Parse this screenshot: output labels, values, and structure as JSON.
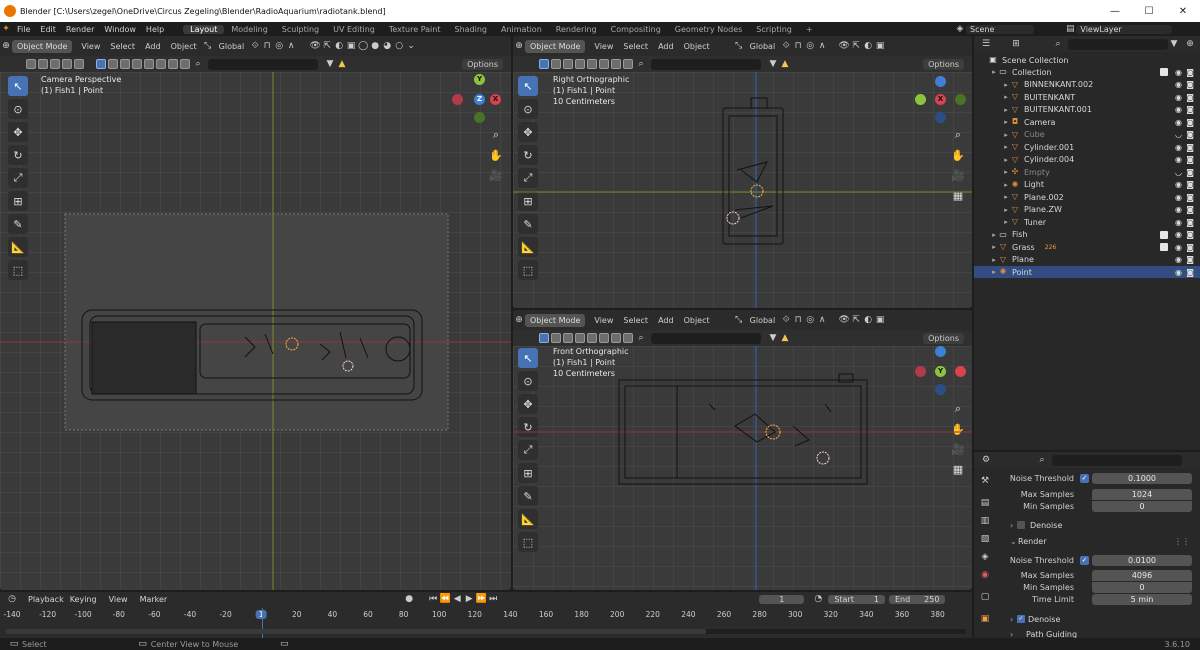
{
  "window": {
    "title": "Blender [C:\\Users\\zegel\\OneDrive\\Circus Zegeling\\Blender\\RadioAquarium\\radiotank.blend]",
    "minimize": "—",
    "maximize": "☐",
    "close": "✕"
  },
  "menus": [
    "File",
    "Edit",
    "Render",
    "Window",
    "Help"
  ],
  "workspaces": [
    "Layout",
    "Modeling",
    "Sculpting",
    "UV Editing",
    "Texture Paint",
    "Shading",
    "Animation",
    "Rendering",
    "Compositing",
    "Geometry Nodes",
    "Scripting"
  ],
  "active_workspace": "Layout",
  "add_workspace": "+",
  "scene": "Scene",
  "view_layer": "ViewLayer",
  "viewport_header": {
    "mode": "Object Mode",
    "view": "View",
    "select": "Select",
    "add": "Add",
    "object": "Object",
    "orientation": "Global",
    "options": "Options"
  },
  "viewports": {
    "camera": {
      "line1": "Camera Perspective",
      "line2": "(1) Fish1 | Point"
    },
    "right": {
      "line1": "Right Orthographic",
      "line2": "(1) Fish1 | Point",
      "line3": "10 Centimeters"
    },
    "front": {
      "line1": "Front Orthographic",
      "line2": "(1) Fish1 | Point",
      "line3": "10 Centimeters"
    }
  },
  "gizmo_labels": {
    "y": "Y",
    "x": "X",
    "z": "Z"
  },
  "outliner": {
    "root": "Scene Collection",
    "items": [
      {
        "label": "Collection",
        "icon": "collection-icon",
        "color": "#e6e6e6",
        "level": 1,
        "dim": false,
        "selected": false,
        "checked": true
      },
      {
        "label": "BINNENKANT.002",
        "icon": "mesh-icon",
        "color": "#e08a3c",
        "level": 2,
        "dim": false,
        "selected": false,
        "checked": false
      },
      {
        "label": "BUITENKANT",
        "icon": "mesh-icon",
        "color": "#e08a3c",
        "level": 2,
        "dim": false,
        "selected": false,
        "checked": false
      },
      {
        "label": "BUITENKANT.001",
        "icon": "mesh-icon",
        "color": "#e08a3c",
        "level": 2,
        "dim": false,
        "selected": false,
        "checked": false
      },
      {
        "label": "Camera",
        "icon": "camera-icon",
        "color": "#e08a3c",
        "level": 2,
        "dim": false,
        "selected": false,
        "checked": false
      },
      {
        "label": "Cube",
        "icon": "mesh-icon",
        "color": "#e08a3c",
        "level": 2,
        "dim": true,
        "selected": false,
        "checked": false
      },
      {
        "label": "Cylinder.001",
        "icon": "mesh-icon",
        "color": "#e08a3c",
        "level": 2,
        "dim": false,
        "selected": false,
        "checked": false
      },
      {
        "label": "Cylinder.004",
        "icon": "mesh-icon",
        "color": "#e08a3c",
        "level": 2,
        "dim": false,
        "selected": false,
        "checked": false
      },
      {
        "label": "Empty",
        "icon": "empty-icon",
        "color": "#e08a3c",
        "level": 2,
        "dim": true,
        "selected": false,
        "checked": false
      },
      {
        "label": "Light",
        "icon": "light-icon",
        "color": "#e08a3c",
        "level": 2,
        "dim": false,
        "selected": false,
        "checked": false
      },
      {
        "label": "Plane.002",
        "icon": "mesh-icon",
        "color": "#e08a3c",
        "level": 2,
        "dim": false,
        "selected": false,
        "checked": false
      },
      {
        "label": "Plane.ZW",
        "icon": "mesh-icon",
        "color": "#e08a3c",
        "level": 2,
        "dim": false,
        "selected": false,
        "checked": false
      },
      {
        "label": "Tuner",
        "icon": "mesh-icon",
        "color": "#e08a3c",
        "level": 2,
        "dim": false,
        "selected": false,
        "checked": false
      },
      {
        "label": "Fish",
        "icon": "collection-icon",
        "color": "#e6e6e6",
        "level": 1,
        "dim": false,
        "selected": false,
        "checked": true
      },
      {
        "label": "Grass",
        "icon": "mesh-icon",
        "color": "#e08a3c",
        "level": 1,
        "dim": false,
        "selected": false,
        "checked": true
      },
      {
        "label": "Plane",
        "icon": "mesh-icon",
        "color": "#e08a3c",
        "level": 1,
        "dim": false,
        "selected": false,
        "checked": false
      },
      {
        "label": "Point",
        "icon": "light-icon",
        "color": "#e08a3c",
        "level": 1,
        "dim": false,
        "selected": true,
        "checked": false
      }
    ],
    "grass_badge": "226"
  },
  "properties": {
    "noise_threshold_1": {
      "label": "Noise Threshold",
      "value": "0.1000"
    },
    "max_samples_1": {
      "label": "Max Samples",
      "value": "1024"
    },
    "min_samples_1": {
      "label": "Min Samples",
      "value": "0"
    },
    "denoise_1": "Denoise",
    "render": "Render",
    "noise_threshold_2": {
      "label": "Noise Threshold",
      "value": "0.0100"
    },
    "max_samples_2": {
      "label": "Max Samples",
      "value": "4096"
    },
    "min_samples_2": {
      "label": "Min Samples",
      "value": "0"
    },
    "time_limit": {
      "label": "Time Limit",
      "value": "5 min"
    },
    "denoise_2": "Denoise",
    "path_guiding": "Path Guiding"
  },
  "timeline": {
    "menus": [
      "Playback",
      "Keying",
      "View",
      "Marker"
    ],
    "current_frame": "1",
    "start_label": "Start",
    "start": "1",
    "end_label": "End",
    "end": "250",
    "ticks": [
      "-140",
      "-120",
      "-100",
      "-80",
      "-60",
      "-40",
      "-20",
      "1",
      "20",
      "40",
      "60",
      "80",
      "100",
      "120",
      "140",
      "160",
      "180",
      "200",
      "220",
      "240",
      "260",
      "280",
      "300",
      "320",
      "340",
      "360",
      "380"
    ]
  },
  "status": {
    "select": "Select",
    "center": "Center View to Mouse",
    "version": "3.6.10"
  }
}
